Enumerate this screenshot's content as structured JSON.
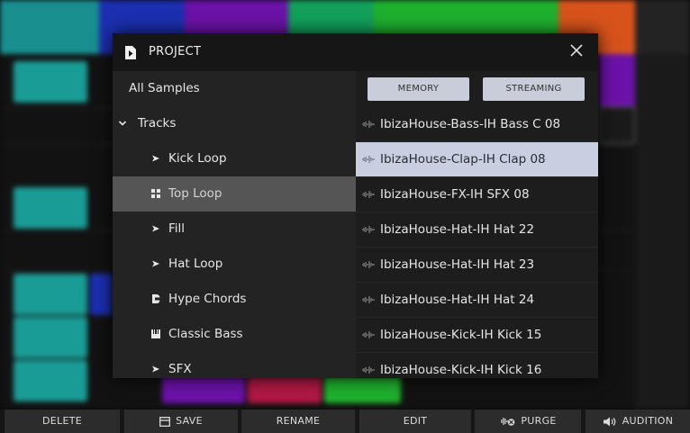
{
  "modal": {
    "title": "PROJECT",
    "close_icon": "close-icon"
  },
  "tree": {
    "root_label": "All Samples",
    "tracks_label": "Tracks",
    "tracks": [
      {
        "label": "Kick Loop",
        "icon": "play-arrow-icon"
      },
      {
        "label": "Top Loop",
        "icon": "drum-grid-icon",
        "selected": true
      },
      {
        "label": "Fill",
        "icon": "play-arrow-icon"
      },
      {
        "label": "Hat Loop",
        "icon": "play-arrow-icon"
      },
      {
        "label": "Hype Chords",
        "icon": "synth-icon"
      },
      {
        "label": "Classic Bass",
        "icon": "keys-icon"
      },
      {
        "label": "SFX",
        "icon": "play-arrow-icon"
      }
    ]
  },
  "toggles": {
    "memory": "MEMORY",
    "streaming": "STREAMING"
  },
  "samples": [
    {
      "name": "IbizaHouse-Bass-IH Bass C 08"
    },
    {
      "name": "IbizaHouse-Clap-IH Clap 08",
      "selected": true
    },
    {
      "name": "IbizaHouse-FX-IH SFX 08"
    },
    {
      "name": "IbizaHouse-Hat-IH Hat 22"
    },
    {
      "name": "IbizaHouse-Hat-IH Hat 23"
    },
    {
      "name": "IbizaHouse-Hat-IH Hat 24"
    },
    {
      "name": "IbizaHouse-Kick-IH Kick 15"
    },
    {
      "name": "IbizaHouse-Kick-IH Kick 16"
    }
  ],
  "bottom_bar": {
    "delete": "DELETE",
    "save": "SAVE",
    "rename": "RENAME",
    "edit": "EDIT",
    "purge": "PURGE",
    "audition": "AUDITION"
  },
  "colors": {
    "selected_sample_bg": "#c9cfe0",
    "selected_track_bg": "#555555",
    "toggle_bg": "#c9ccd9",
    "bg_track_orange": "#d8531c",
    "bg_track_blue": "#1c2fb0",
    "bg_track_teal": "#1a9c96",
    "bg_track_purple": "#6b12a8",
    "bg_track_green": "#1fb02e",
    "bg_track_crimson": "#b01844"
  }
}
